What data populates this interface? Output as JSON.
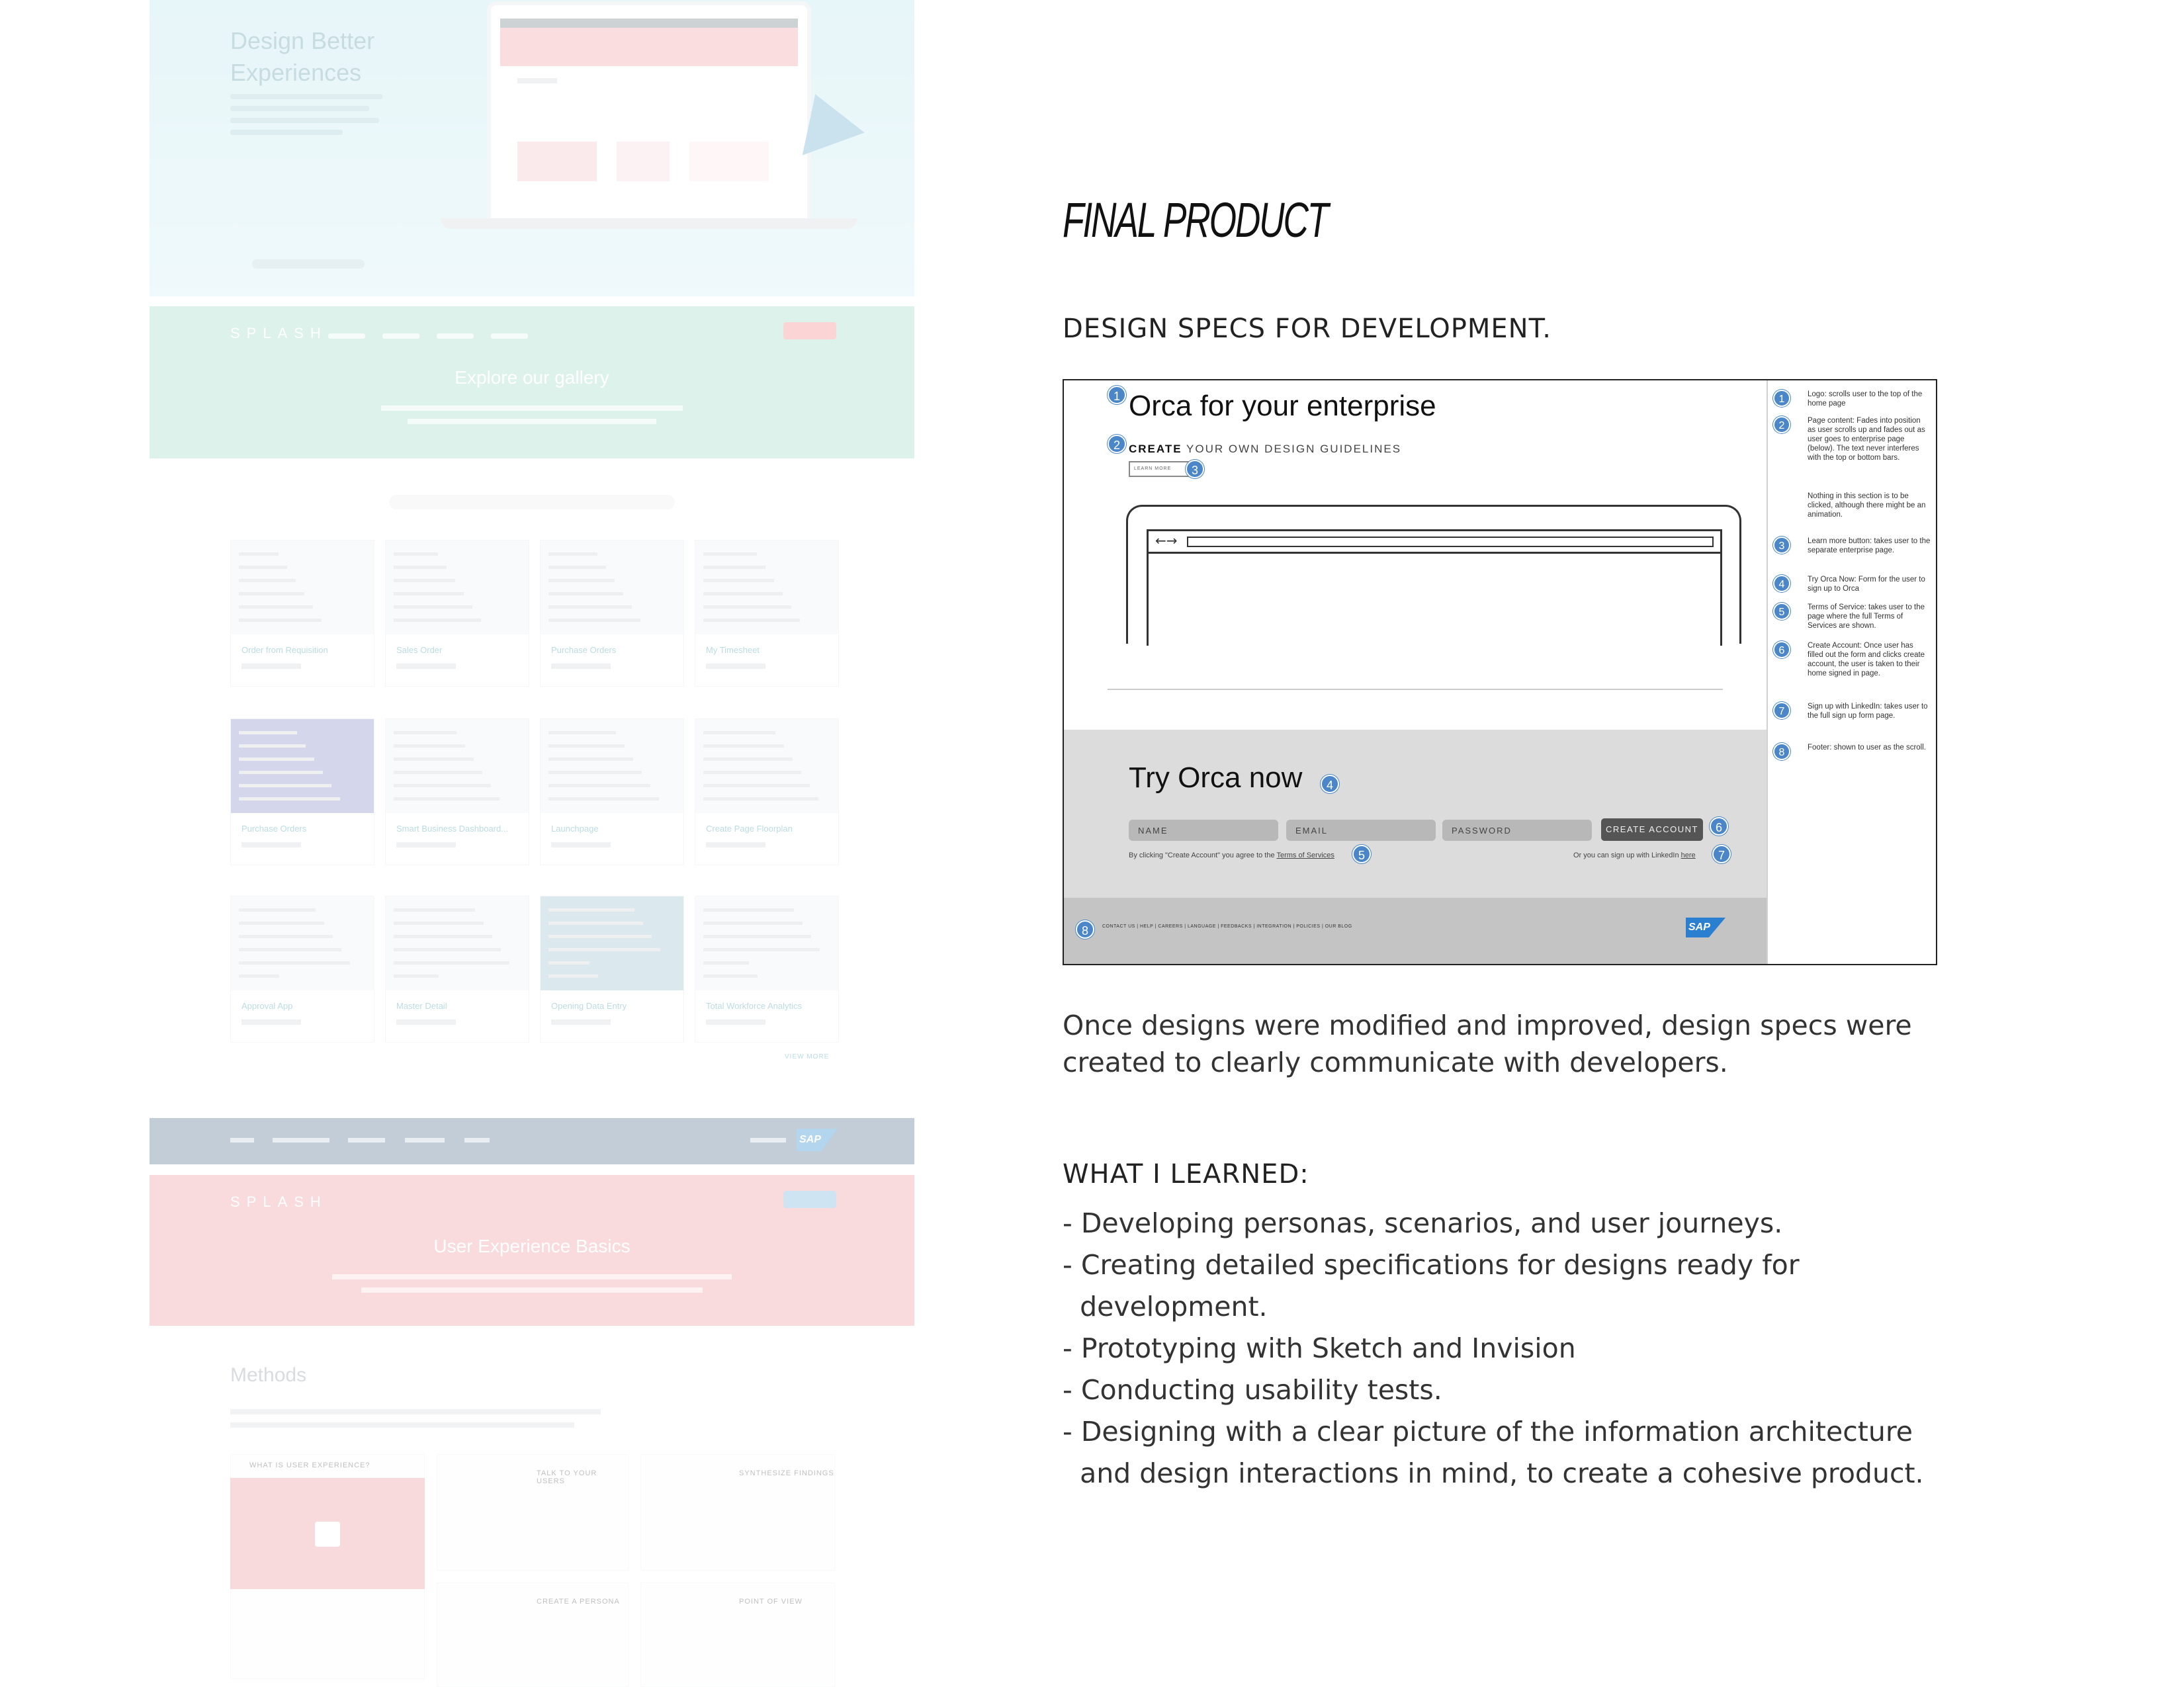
{
  "left": {
    "hero_title_line1": "Design Better",
    "hero_title_line2": "Experiences",
    "gallery_brand": "SPLASH",
    "gallery_title": "Explore our gallery",
    "cards": [
      {
        "name": "Order from Requisition"
      },
      {
        "name": "Sales Order"
      },
      {
        "name": "Purchase Orders"
      },
      {
        "name": "My Timesheet"
      },
      {
        "name": "Purchase Orders"
      },
      {
        "name": "Smart Business Dashboard..."
      },
      {
        "name": "Launchpage"
      },
      {
        "name": "Create Page Floorplan"
      },
      {
        "name": "Approval App"
      },
      {
        "name": "Master Detail"
      },
      {
        "name": "Opening Data Entry"
      },
      {
        "name": "Total Workforce Analytics"
      }
    ],
    "view_more": "VIEW MORE",
    "footer_sap": "SAP",
    "ux_brand": "SPLASH",
    "ux_title": "User Experience Basics",
    "methods_title": "Methods",
    "method_cards": [
      "WHAT IS USER EXPERIENCE?",
      "TALK TO YOUR USERS",
      "SYNTHESIZE FINDINGS",
      "CREATE A PERSONA",
      "POINT OF VIEW"
    ]
  },
  "final_title": "FINAL PRODUCT",
  "specs_heading": "DESIGN SPECS FOR DEVELOPMENT.",
  "spec": {
    "title": "Orca for your enterprise",
    "sub_bold": "CREATE",
    "sub_rest": " YOUR OWN DESIGN GUIDELINES",
    "learn_more": "LEARN MORE",
    "try_title": "Try Orca now",
    "fields": {
      "name": "NAME",
      "email": "EMAIL",
      "password": "PASSWORD"
    },
    "create_button": "CREATE ACCOUNT",
    "terms_prefix": "By clicking \"Create Account\" you agree to the ",
    "terms_link": "Terms of Services",
    "linkedin_prefix": "Or you can sign up with LinkedIn ",
    "linkedin_link": "here",
    "footer_links": "CONTACT US  |  HELP  |  CAREERS  |  LANGUAGE  |  FEEDBACKS  |  INTEGRATION  |  POLICIES  |  OUR BLOG",
    "sap_logo": "SAP",
    "markers": [
      "1",
      "2",
      "3",
      "4",
      "5",
      "6",
      "7",
      "8"
    ],
    "notes": [
      {
        "n": "1",
        "text": "Logo: scrolls user to the top of the home page"
      },
      {
        "n": "2",
        "text": "Page content: Fades into position as user scrolls up and fades out as user goes to enterprise page (below). The text never interferes with the top or bottom bars."
      },
      {
        "extra": "Nothing in this section is to be clicked, although there might be an animation."
      },
      {
        "n": "3",
        "text": "Learn more button: takes user to the separate enterprise page."
      },
      {
        "n": "4",
        "text": "Try Orca Now: Form for the user to sign up to Orca"
      },
      {
        "n": "5",
        "text": "Terms of Service: takes user to the page where the full Terms of Services are shown."
      },
      {
        "n": "6",
        "text": "Create Account: Once user has filled out the form and clicks create account, the user is taken to their home signed in page."
      },
      {
        "n": "7",
        "text": "Sign up with LinkedIn: takes user to the full sign up form page."
      },
      {
        "n": "8",
        "text": "Footer: shown to user as the scroll."
      }
    ]
  },
  "paragraph_line1": "Once designs were modified and improved, design specs were",
  "paragraph_line2": "created to clearly communicate with developers.",
  "learned_heading": "WHAT I LEARNED:",
  "learned_items": [
    "- Developing personas, scenarios, and user journeys.",
    "- Creating detailed specifications for designs ready for",
    "  development.",
    "- Prototyping with Sketch and Invision",
    "- Conducting usability tests.",
    "- Designing with a clear picture of the information architecture",
    "  and design interactions in mind, to create a cohesive product."
  ]
}
